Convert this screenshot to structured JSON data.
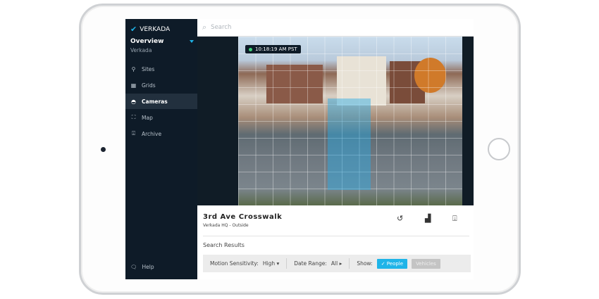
{
  "brand": "VERKADA",
  "org": {
    "title": "Overview",
    "subtitle": "Verkada"
  },
  "nav": [
    {
      "label": "Sites",
      "icon": "pin-icon"
    },
    {
      "label": "Grids",
      "icon": "grid-icon"
    },
    {
      "label": "Cameras",
      "icon": "camera-icon"
    },
    {
      "label": "Map",
      "icon": "map-icon"
    },
    {
      "label": "Archive",
      "icon": "archive-icon"
    }
  ],
  "help": "Help",
  "search": {
    "placeholder": "Search"
  },
  "video": {
    "timestamp": "10:18:19 AM PST"
  },
  "camera": {
    "name": "3rd Ave Crosswalk",
    "location": "Verkada HQ - Outside"
  },
  "results": {
    "title": "Search Results",
    "motion_label": "Motion Sensitivity:",
    "motion_value": "High",
    "date_label": "Date Range:",
    "date_value": "All",
    "show_label": "Show:",
    "people": "People",
    "vehicles": "Vehicles"
  },
  "colors": {
    "accent": "#1fb4e8",
    "sidebar": "#0e1b28"
  }
}
